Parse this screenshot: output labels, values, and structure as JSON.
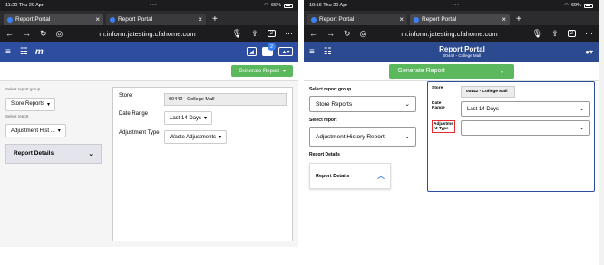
{
  "left": {
    "status": {
      "time": "11:20 Thu 20 Apr",
      "dots": "•••",
      "battery": "66%"
    },
    "tabs": [
      {
        "label": "Report Portal"
      },
      {
        "label": "Report Portal"
      }
    ],
    "url": "m.inform.jatesting.cfahome.com",
    "tab_count": "2",
    "notify_badge": "2",
    "logo": "m",
    "generate_label": "Generate Report",
    "select_group_label": "Select report group",
    "select_group_value": "Store Reports",
    "select_report_label": "Select report",
    "select_report_value": "Adjustment Hist ...",
    "details_label": "Report Details",
    "store_label": "Store",
    "store_value": "00442 - College Mall",
    "date_label": "Date Range",
    "date_value": "Last 14 Days",
    "adj_label": "Adjustment Type",
    "adj_value": "Waste Adjustments"
  },
  "right": {
    "status": {
      "time": "10:16 Thu 20 Apr",
      "dots": "•••",
      "battery": "69%"
    },
    "tabs": [
      {
        "label": "Report Portal"
      },
      {
        "label": "Report Portal"
      }
    ],
    "url": "m.inform.jatesting.cfahome.com",
    "tab_count": "2",
    "title": "Report Portal",
    "subtitle": "00442 - College Mall",
    "generate_label": "Generate Report",
    "select_group_label": "Select report group",
    "select_group_value": "Store Reports",
    "select_report_label": "Select report",
    "select_report_value": "Adjustment History Report",
    "details_section_label": "Report Details",
    "details_label": "Report Details",
    "store_label": "Store",
    "store_value": "00442 - College Mall",
    "date_label": "Date Range",
    "date_value": "Last 14 Days",
    "adj_label": "Adjustme nt Type",
    "adj_value": ""
  },
  "colors": {
    "header": "#2d4ea0",
    "generate": "#5cb85c",
    "highlight": "#e52b2b"
  }
}
